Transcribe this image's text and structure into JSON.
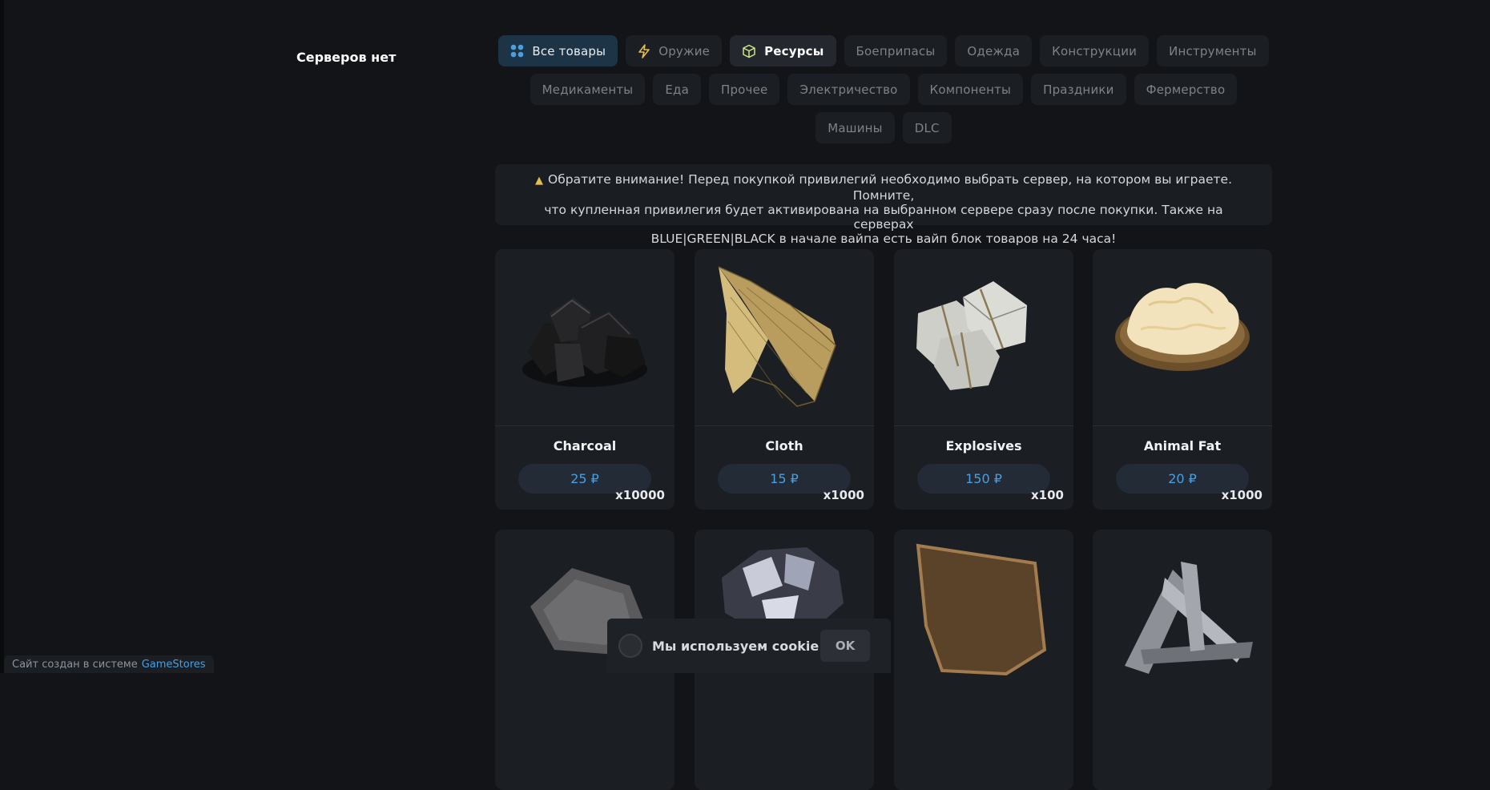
{
  "sidebar": {
    "servers_label": "Серверов нет"
  },
  "categories": {
    "row1": [
      "Все товары",
      "Оружие",
      "Ресурсы",
      "Боеприпасы",
      "Одежда",
      "Конструкции",
      "Инструменты"
    ],
    "row2": [
      "Медикаменты",
      "Еда",
      "Прочее",
      "Электричество",
      "Компоненты",
      "Праздники",
      "Фермерство"
    ],
    "row3": [
      "Машины",
      "DLC"
    ],
    "selected": "Ресурсы"
  },
  "icons": {
    "all": "grid-icon",
    "weapons": "lightning-icon",
    "resources": "cube-icon",
    "notice": "warning-icon",
    "cookie": "cookie-icon"
  },
  "notice": {
    "line1": "Обратите внимание! Перед покупкой привилегий необходимо выбрать сервер, на котором вы играете. Помните,",
    "line2": "что купленная привилегия будет активирована на выбранном сервере сразу после покупки. Также на серверах",
    "line3": "BLUE|GREEN|BLACK в начале вайпа есть вайп блок товаров на 24 часа!"
  },
  "products": [
    {
      "name": "Charcoal",
      "price": "25 ₽",
      "qty": "x10000"
    },
    {
      "name": "Cloth",
      "price": "15 ₽",
      "qty": "x1000"
    },
    {
      "name": "Explosives",
      "price": "150 ₽",
      "qty": "x100"
    },
    {
      "name": "Animal Fat",
      "price": "20 ₽",
      "qty": "x1000"
    }
  ],
  "cookie": {
    "text": "Мы используем cookie",
    "ok_label": "OK"
  },
  "footer": {
    "credit_text": "Сайт создан в системе",
    "credit_brand": "GameStores"
  },
  "colors": {
    "background": "#121418",
    "card": "#1b1e23",
    "accent": "#4a9fe0",
    "selected_tab": "#1d3446",
    "warning": "#e3c04a"
  }
}
